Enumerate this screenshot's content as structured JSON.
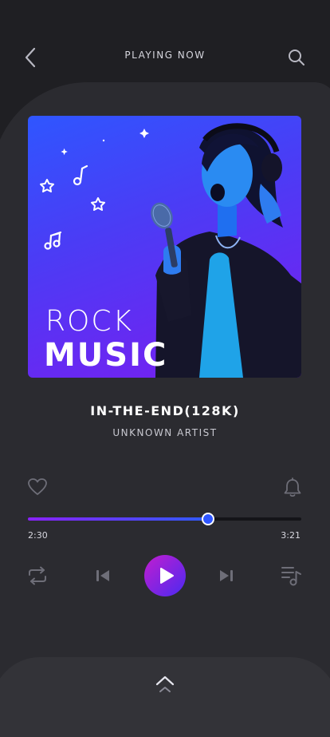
{
  "header": {
    "title": "Playing Now",
    "back_icon": "back-icon",
    "search_icon": "search-icon"
  },
  "cover": {
    "line1": "Rock",
    "line2": "Music"
  },
  "track": {
    "title": "In-The-End(128K)",
    "artist": "unknown artist"
  },
  "progress": {
    "current": "2:30",
    "total": "3:21",
    "fraction": 0.658
  },
  "controls": {
    "repeat": "repeat-icon",
    "previous": "previous-icon",
    "play": "play-icon",
    "next": "next-icon",
    "playlist": "playlist-icon"
  },
  "colors": {
    "accent_purple": "#8a22ff",
    "accent_blue": "#2f56ff",
    "background": "#1f1f23"
  }
}
